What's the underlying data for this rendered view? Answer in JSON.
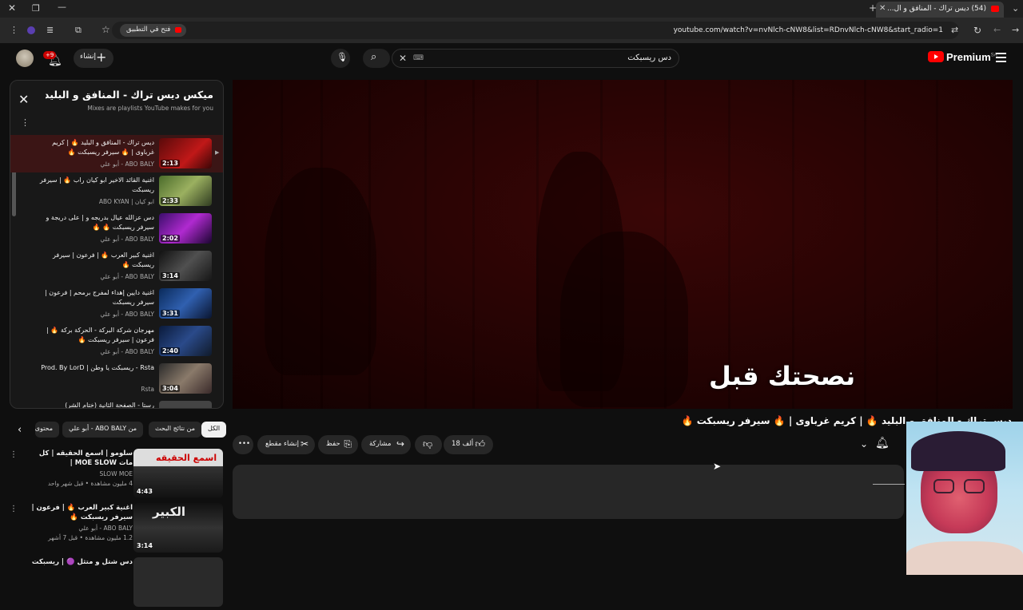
{
  "browser": {
    "tab_title": "(54) دیس تراك - المنافق و ال...",
    "url": "youtube.com/watch?v=nvNlch-cNW8&list=RDnvNlch-cNW8&start_radio=1",
    "open_in_app": "فتح في التطبيق"
  },
  "header": {
    "logo": "Premium",
    "region": "SA",
    "search_value": "دس ريسبكت",
    "create_label": "إنشاء",
    "notif_count": "+9"
  },
  "playlist": {
    "title": "ميكس ديس تراك - المنافق و البليد...",
    "subtitle": "Mixes are playlists YouTube makes for you",
    "items": [
      {
        "title": "دیس تراك - المنافق و البليد 🔥 | كريم غرباوى | 🔥 سيرفر ريسبكت 🔥",
        "channel": "ABO BALY - أبو علي",
        "duration": "2:13",
        "active": true
      },
      {
        "title": "اغنية القائد الاخير ابو كيان راب 🔥 | سيرفر ريسبكت",
        "channel": "ابو كيان | ABO KYAN",
        "duration": "2:33",
        "active": false
      },
      {
        "title": "دس عزالله عيال بدريجه و | على دريجة و سيرفر ريسبكت 🔥 🔥",
        "channel": "ABO BALY - أبو علي",
        "duration": "2:02",
        "active": false
      },
      {
        "title": "اغنية كبير العرب 🔥 | فرعون | سيرفر ريسبكت 🔥",
        "channel": "ABO BALY - أبو علي",
        "duration": "3:14",
        "active": false
      },
      {
        "title": "اغنية دايين إهداء لمفرج برمحم | فرعون | سيرفر ريسبكت",
        "channel": "ABO BALY - أبو علي",
        "duration": "3:31",
        "active": false
      },
      {
        "title": "مهرجان شركة البركة - الحركة بركة 🔥 | فرعون | سيرفر ريسبكت 🔥",
        "channel": "ABO BALY - أبو علي",
        "duration": "2:40",
        "active": false
      },
      {
        "title": "Rsta - ريسبكت يا وطن | Prod. By LorD",
        "channel": "Rsta",
        "duration": "3:04",
        "active": false
      },
      {
        "title": "رستا - الصفحة الثانية (ختام الشر)",
        "channel": "",
        "duration": "",
        "active": false
      }
    ]
  },
  "chips": [
    {
      "label": "الكل",
      "active": true
    },
    {
      "label": "من نتائج البحث",
      "active": false
    },
    {
      "label": "من ABO BALY - أبو علي",
      "active": false
    },
    {
      "label": "محتوى",
      "active": false
    }
  ],
  "recommendations": [
    {
      "title": "سلومو | اسمع الحقيقه | كل مات MOE SLOW |",
      "channel": "SLOW MOE",
      "meta": "4 مليون مشاهدة • قبل شهر واحد",
      "duration": "4:43",
      "thumb_text": "اسمع الحقيقه"
    },
    {
      "title": "اغنية كبير العرب 🔥 | فرعون | سيرفر ريسبكت 🔥",
      "channel": "ABO BALY - أبو علي",
      "meta": "1.2 مليون مشاهدة • قبل 7 أشهر",
      "duration": "3:14",
      "thumb_text": "الكبير"
    },
    {
      "title": "دس شتل و متثل 🟣 | ريسبكت",
      "channel": "",
      "meta": "",
      "duration": "",
      "thumb_text": ""
    }
  ],
  "video": {
    "caption": "نصحتك قبل",
    "title": "دیس تراك - المنافق و البليد 🔥 | كريم غرباوى | 🔥 سيرفر ريسبكت 🔥"
  },
  "actions": {
    "likes": "18 ألف",
    "share": "مشاركة",
    "save": "حفظ",
    "clip": "إنشاء مقطع"
  }
}
